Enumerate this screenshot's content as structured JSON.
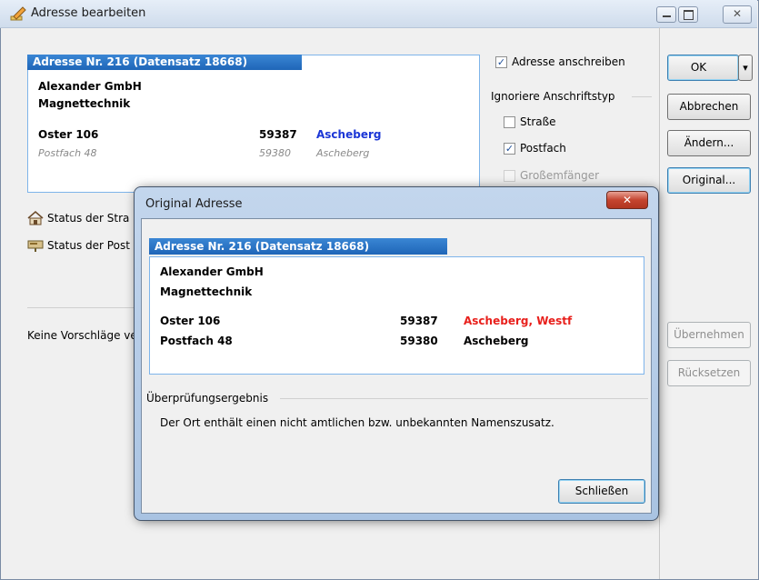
{
  "window": {
    "title": "Adresse bearbeiten",
    "close_glyph": "✕"
  },
  "address": {
    "header": "Adresse Nr. 216 (Datensatz 18668)",
    "name1": "Alexander GmbH",
    "name2": "Magnettechnik",
    "street": "Oster 106",
    "street_zip": "59387",
    "street_city": "Ascheberg",
    "pobox": "Postfach 48",
    "pobox_zip": "59380",
    "pobox_city": "Ascheberg"
  },
  "options": {
    "write_to_address": "Adresse anschreiben",
    "ignore_group": "Ignoriere Anschriftstyp",
    "street": "Straße",
    "pobox": "Postfach",
    "big_recipient": "Großemfänger"
  },
  "status": {
    "street": "Status der Stra",
    "pobox": "Status der Post",
    "no_suggestions": "Keine Vorschläge ve"
  },
  "buttons": {
    "ok": "OK",
    "cancel": "Abbrechen",
    "change": "Ändern...",
    "original": "Original...",
    "apply": "Übernehmen",
    "reset": "Rücksetzen",
    "dropdown_glyph": "▾"
  },
  "dialog": {
    "title": "Original Adresse",
    "close_glyph": "✕",
    "header": "Adresse Nr. 216 (Datensatz 18668)",
    "name1": "Alexander GmbH",
    "name2": "Magnettechnik",
    "street": "Oster 106",
    "street_zip": "59387",
    "street_city": "Ascheberg, Westf",
    "pobox": "Postfach 48",
    "pobox_zip": "59380",
    "pobox_city": "Ascheberg",
    "result_label": "Überprüfungsergebnis",
    "result_text": "Der Ort enthält einen nicht amtlichen bzw. unbekannten Namenszusatz.",
    "close_button": "Schließen"
  },
  "colors": {
    "accent": "#1f66b8",
    "warning": "#e8201c",
    "city_ok": "#1b36d6"
  },
  "icons": {
    "app": "edit-pencil-icon",
    "street_status": "house-icon",
    "pobox_status": "mailbox-icon"
  }
}
